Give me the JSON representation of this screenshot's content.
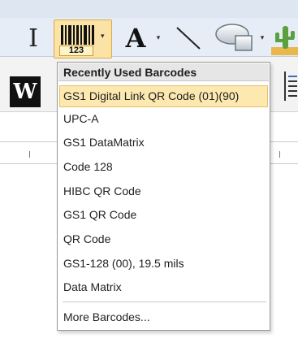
{
  "toolbar": {
    "barcode_number": "123",
    "font_glyph": "A",
    "bold_glyph": "W",
    "text_tool_glyph": "I",
    "dropdown_arrow": "▾"
  },
  "menu": {
    "header": "Recently Used Barcodes",
    "items": [
      {
        "label": "GS1 Digital Link QR Code (01)(90)"
      },
      {
        "label": "UPC-A"
      },
      {
        "label": "GS1 DataMatrix"
      },
      {
        "label": "Code 128"
      },
      {
        "label": "HIBC QR Code"
      },
      {
        "label": "GS1 QR Code"
      },
      {
        "label": "QR Code"
      },
      {
        "label": "GS1-128 (00), 19.5 mils"
      },
      {
        "label": "Data Matrix"
      }
    ],
    "more": "More Barcodes..."
  },
  "colors": {
    "selected_bg": "#fde8b0",
    "selected_border": "#e7bf6b",
    "toolbar_bg": "#e6edf6"
  }
}
